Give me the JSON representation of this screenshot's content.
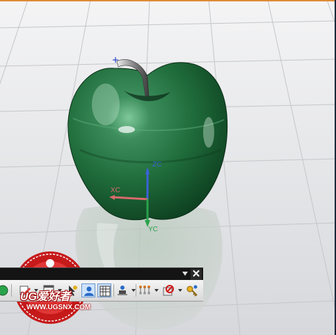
{
  "viewport": {
    "background_color": "#e9eaec",
    "model_color": "#1f6b3a",
    "accent_color": "#e08a36"
  },
  "axes": {
    "z_label": "ZC",
    "x_label": "XC",
    "y_label": "YC",
    "z_color": "#3a62d8",
    "x_color": "#d86a6a",
    "y_color": "#2aa34a"
  },
  "toolbar": {
    "close_glyph": "✕",
    "buttons": [
      {
        "name": "green-status-icon"
      },
      {
        "name": "pencil-edit-icon"
      },
      {
        "name": "new-part-icon"
      },
      {
        "name": "pointer-select-icon"
      },
      {
        "name": "user-role-icon"
      },
      {
        "name": "grid-display-icon"
      },
      {
        "name": "user-person-icon"
      },
      {
        "name": "assembly-nodes-icon"
      },
      {
        "name": "no-entry-icon"
      },
      {
        "name": "key-icon"
      }
    ]
  },
  "watermark": {
    "brand": "UG爱好者",
    "url": "WWW.UGSNX.COM"
  }
}
